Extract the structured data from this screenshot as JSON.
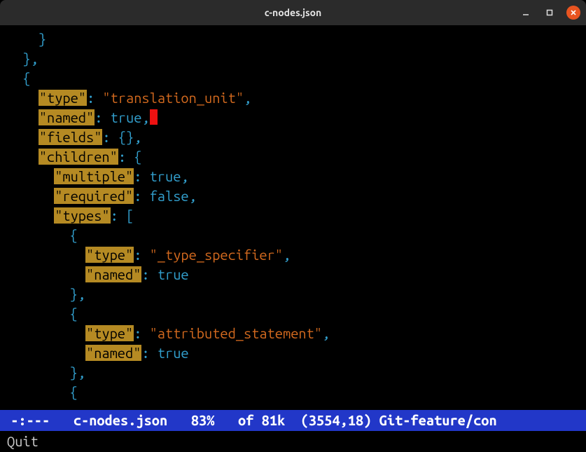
{
  "window": {
    "title": "c-nodes.json"
  },
  "code": {
    "k_type": "\"type\"",
    "k_named": "\"named\"",
    "k_fields": "\"fields\"",
    "k_children": "\"children\"",
    "k_multiple": "\"multiple\"",
    "k_required": "\"required\"",
    "k_types": "\"types\"",
    "v_translation_unit": "\"translation_unit\"",
    "v_type_specifier": "\"_type_specifier\"",
    "v_attributed_statement": "\"attributed_statement\"",
    "v_true": "true",
    "v_false": "false",
    "brace_open": "{",
    "brace_close": "}",
    "bracket_open": "[",
    "empty_obj": "{}",
    "colon": ":",
    "comma": ","
  },
  "modeline": {
    "state": "-:---",
    "buffer": "c-nodes.json",
    "percent": "83%",
    "of": "of 81k",
    "pos": "(3554,18)",
    "vcs": "Git-feature/con"
  },
  "minibuffer": {
    "text": "Quit"
  }
}
